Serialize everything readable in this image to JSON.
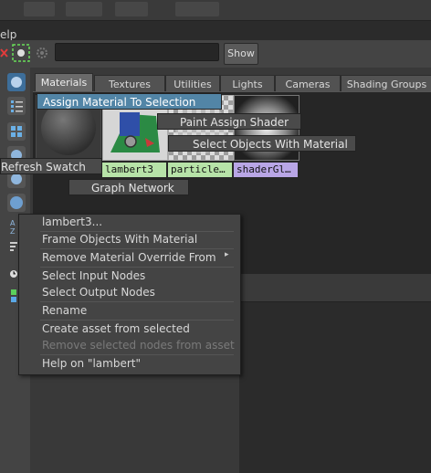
{
  "menubar": {
    "help_label": "elp"
  },
  "toolbar": {
    "search_value": "",
    "show_label": "Show"
  },
  "tabs": [
    "Materials",
    "Textures",
    "Utilities",
    "Lights",
    "Cameras",
    "Shading Groups"
  ],
  "swatches": [
    {
      "label": ""
    },
    {
      "label": "lambert3"
    },
    {
      "label": "particle…"
    },
    {
      "label": "shaderGl…"
    }
  ],
  "marking_menu": {
    "assign": "Assign Material To Selection",
    "paint": "Paint Assign Shader",
    "select_objects": "Select Objects With Material",
    "refresh": "Refresh Swatch",
    "graph": "Graph Network"
  },
  "context_menu": {
    "title": "lambert3...",
    "items": [
      "Frame Objects With Material",
      "Remove Material Override From",
      "Select Input Nodes",
      "Select Output Nodes",
      "Rename",
      "Create asset from selected",
      "Remove selected nodes from asset",
      "Help on \"lambert\""
    ],
    "submenu_arrow": "▸"
  },
  "colors": {
    "highlight": "#5285a6",
    "lambert_label_bg": "#b7e3a8",
    "particle_label_bg": "#b7e3a8",
    "shader_label_bg": "#b9a6e6"
  }
}
